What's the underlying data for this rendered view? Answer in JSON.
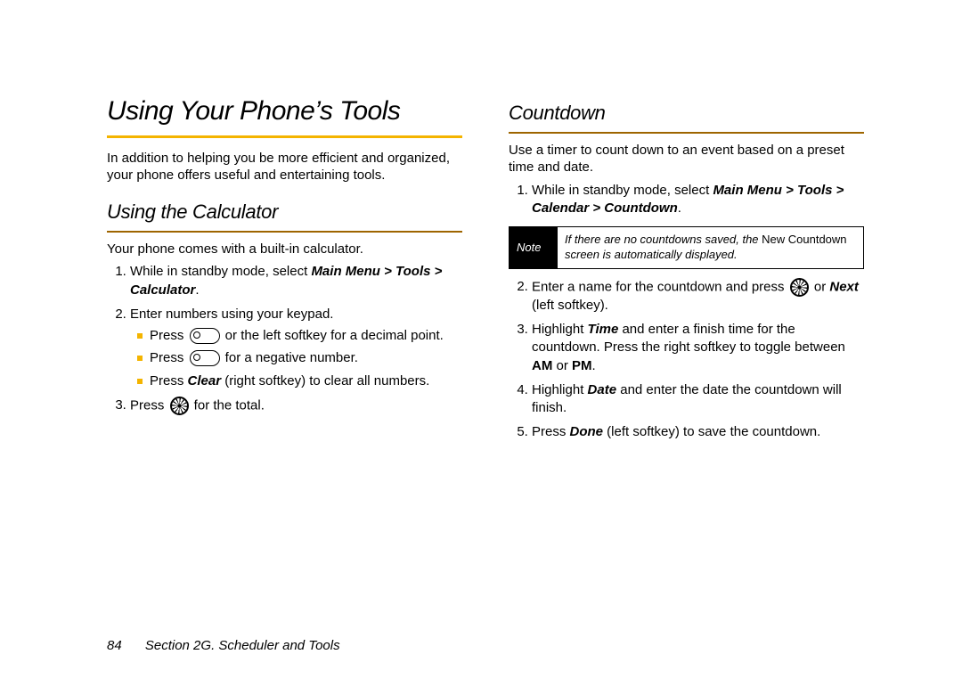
{
  "left": {
    "title": "Using Your Phone’s Tools",
    "intro": "In addition to helping you be more efficient and organized, your phone offers useful and entertaining tools.",
    "h2": "Using the Calculator",
    "p1": "Your phone comes with a built-in calculator.",
    "step1_a": "While in standby mode, select ",
    "step1_b": "Main Menu > Tools > Calculator",
    "step1_c": ".",
    "step2": "Enter numbers using your keypad.",
    "sub1_a": "Press ",
    "sub1_b": " or the left softkey for a decimal point.",
    "sub2_a": "Press ",
    "sub2_b": " for a negative number.",
    "sub3_a": "Press ",
    "sub3_b": "Clear",
    "sub3_c": " (right softkey) to clear all numbers.",
    "step3_a": "Press ",
    "step3_b": " for the total."
  },
  "right": {
    "h2": "Countdown",
    "p1": "Use a timer to count down to an event based on a preset time and date.",
    "step1_a": "While in standby mode, select ",
    "step1_b": "Main Menu > Tools > Calendar > Countdown",
    "step1_c": ".",
    "note_label": "Note",
    "note_a": "If there are no countdowns saved, the ",
    "note_b": "New Countdown",
    "note_c": " screen is automatically displayed.",
    "step2_a": "Enter a name for the countdown and press ",
    "step2_b": " or ",
    "step2_c": "Next",
    "step2_d": " (left softkey).",
    "step3_a": "Highlight ",
    "step3_b": "Time",
    "step3_c": " and enter a finish time for the countdown. Press the right softkey to toggle between ",
    "step3_d": "AM",
    "step3_e": " or ",
    "step3_f": "PM",
    "step3_g": ".",
    "step4_a": "Highlight ",
    "step4_b": "Date",
    "step4_c": " and enter the date the countdown will finish.",
    "step5_a": "Press ",
    "step5_b": "Done",
    "step5_c": " (left softkey) to save the countdown."
  },
  "footer": {
    "page": "84",
    "section": "Section 2G. Scheduler and Tools"
  }
}
